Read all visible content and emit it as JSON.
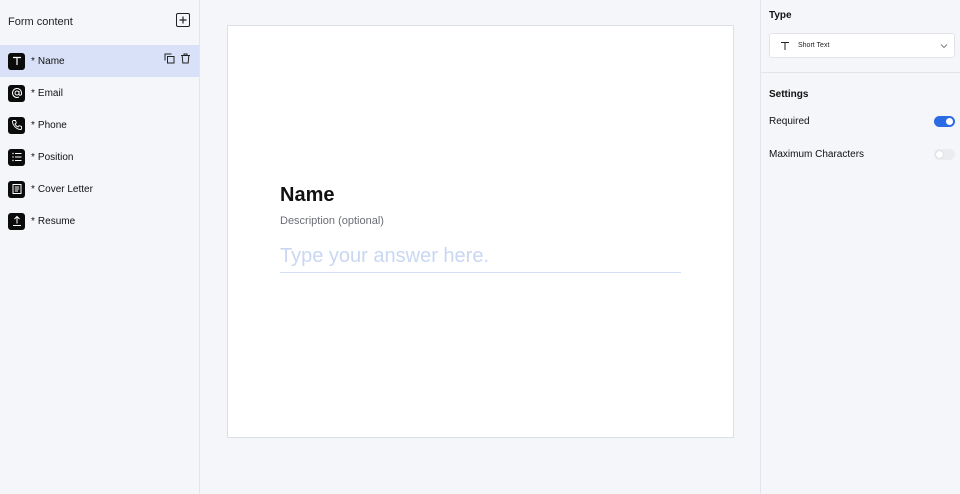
{
  "sidebar": {
    "title": "Form content",
    "add_icon": "plus-square-icon",
    "items": [
      {
        "label": "Name",
        "icon": "text-T-icon",
        "required_mark": "*"
      },
      {
        "label": "Email",
        "icon": "at-sign-icon",
        "required_mark": "*"
      },
      {
        "label": "Phone",
        "icon": "phone-icon",
        "required_mark": "*"
      },
      {
        "label": "Position",
        "icon": "list-icon",
        "required_mark": "*"
      },
      {
        "label": "Cover Letter",
        "icon": "document-icon",
        "required_mark": "*"
      },
      {
        "label": "Resume",
        "icon": "upload-icon",
        "required_mark": "*"
      }
    ],
    "active_index": 0,
    "item_action_icons": [
      "duplicate-icon",
      "trash-icon"
    ]
  },
  "question": {
    "title": "Name",
    "description": "Description (optional)",
    "placeholder": "Type your answer here."
  },
  "panel": {
    "type_heading": "Type",
    "type_value": "Short Text",
    "type_icon": "text-T-icon",
    "settings_heading": "Settings",
    "settings": [
      {
        "label": "Required",
        "enabled": true
      },
      {
        "label": "Maximum Characters",
        "enabled": false
      }
    ]
  },
  "colors": {
    "accent": "#2b6be4",
    "active_row": "#d8e1f8",
    "background": "#f5f6fa"
  }
}
